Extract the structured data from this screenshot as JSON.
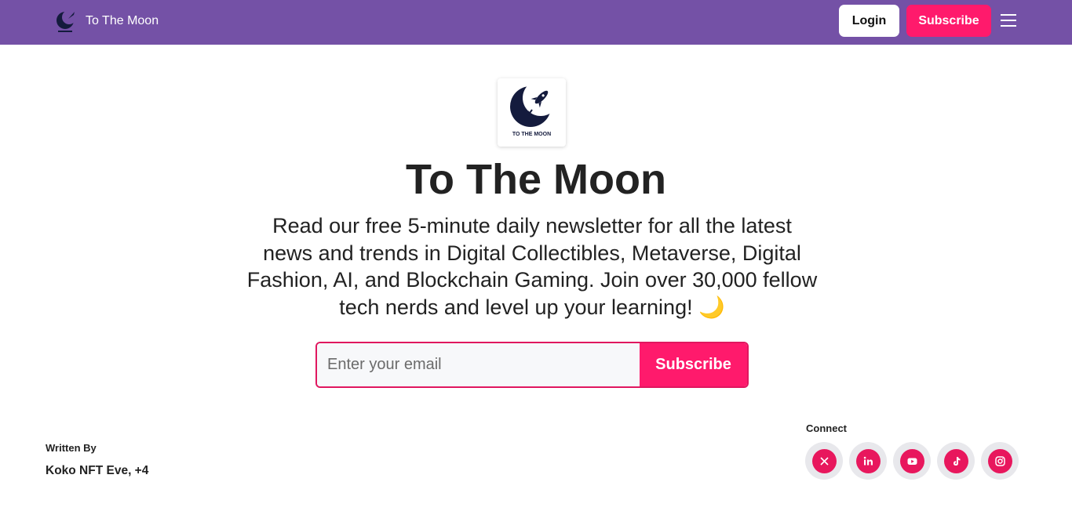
{
  "header": {
    "brand_name": "To The Moon",
    "login_label": "Login",
    "subscribe_label": "Subscribe",
    "menu_icon": "hamburger-icon",
    "colors": {
      "bar": "#7451a6",
      "accent": "#ff1a6c"
    }
  },
  "hero": {
    "logo_text": "TO THE MOON",
    "title": "To The Moon",
    "description": "Read our free 5-minute daily newsletter for all the latest news and trends in Digital Collectibles, Metaverse, Digital Fashion, AI, and Blockchain Gaming. Join over 30,000 fellow tech nerds and level up your learning! 🌙",
    "email_placeholder": "Enter your email",
    "subscribe_label": "Subscribe"
  },
  "footer": {
    "written_by_label": "Written By",
    "authors": "Koko NFT Eve, +4",
    "connect_label": "Connect",
    "socials": [
      "x-icon",
      "linkedin-icon",
      "youtube-icon",
      "tiktok-icon",
      "instagram-icon"
    ]
  }
}
